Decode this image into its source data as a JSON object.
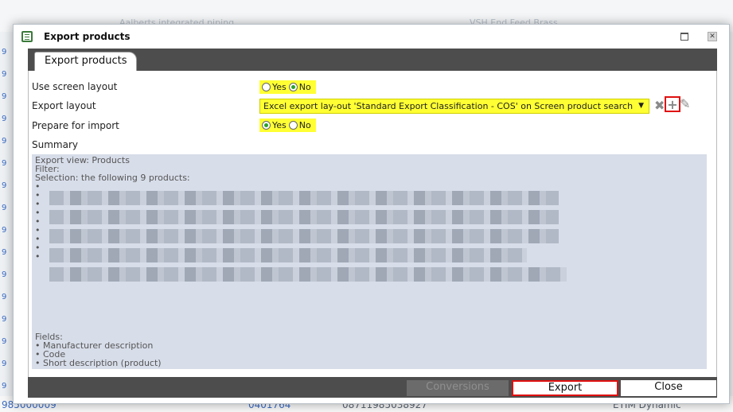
{
  "background": {
    "bottom_row": [
      "985000009",
      "0401764",
      "08711985038927",
      "ETIM Dynamic"
    ],
    "bottom_row_ghost": [
      "Aalberts integrated piping",
      "VSH End Feed Brass"
    ],
    "left_numbers": [
      "9",
      "9",
      "9",
      "9",
      "9",
      "9",
      "9",
      "9",
      "9",
      "9",
      "9",
      "9",
      "9",
      "9",
      "9",
      "9"
    ]
  },
  "dialog": {
    "title": "Export products",
    "tab_label": "Export products",
    "use_screen_layout": {
      "label": "Use screen layout",
      "yes": "Yes",
      "no": "No",
      "selected": "No"
    },
    "export_layout": {
      "label": "Export layout",
      "value": "Excel export lay-out 'Standard Export Classification - COS' on Screen product search"
    },
    "prepare_for_import": {
      "label": "Prepare for import",
      "yes": "Yes",
      "no": "No",
      "selected": "Yes"
    },
    "summary": {
      "label": "Summary",
      "export_view": "Export view: Products",
      "filter": "Filter:",
      "selection": "Selection: the following 9 products:",
      "fields_label": "Fields:",
      "fields": [
        "Manufacturer description",
        "Code",
        "Short description (product)"
      ]
    },
    "footer": {
      "conversions": "Conversions",
      "export": "Export",
      "close": "Close"
    }
  },
  "colors": {
    "highlight": "#ffff33",
    "dark_bar": "#4d4d4d",
    "summary_bg": "#d7dde9",
    "callout_red": "#e01010"
  }
}
